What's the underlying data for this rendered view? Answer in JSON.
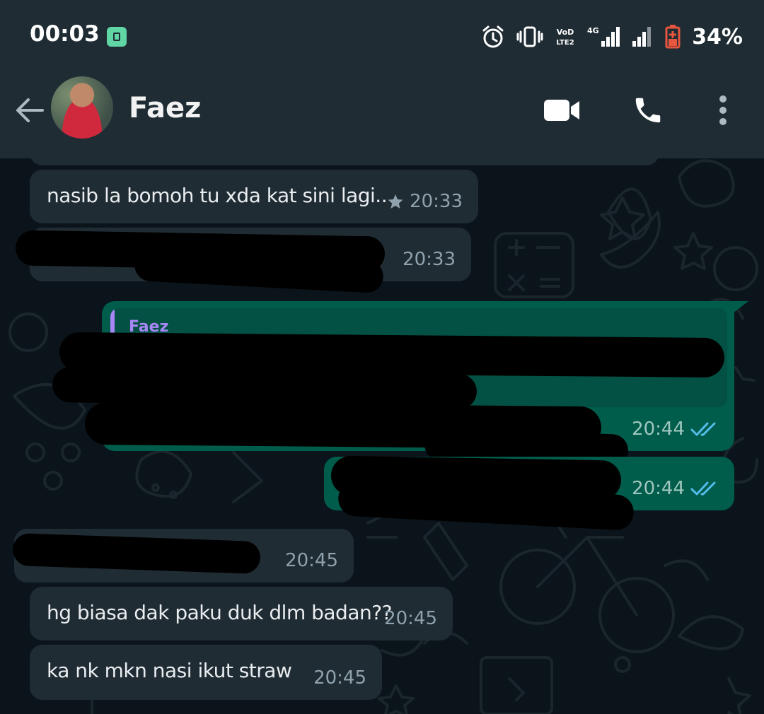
{
  "status_bar": {
    "time": "00:03",
    "battery_percent": "34%",
    "network": "4G",
    "volte": "VoLTE"
  },
  "header": {
    "contact_name": "Faez"
  },
  "messages": [
    {
      "direction": "incoming",
      "text": "nasib la bomoh tu xda kat sini lagi..",
      "time": "20:33",
      "starred": true
    },
    {
      "direction": "incoming",
      "text": "",
      "time": "20:33",
      "redacted": true
    },
    {
      "direction": "outgoing",
      "quoted_name": "Faez",
      "text": "",
      "time": "20:44",
      "read": true,
      "redacted": true
    },
    {
      "direction": "outgoing",
      "text": "",
      "time": "20:44",
      "read": true,
      "redacted": true
    },
    {
      "direction": "incoming",
      "text": "",
      "time": "20:45",
      "redacted": true
    },
    {
      "direction": "incoming",
      "text": "hg biasa dak paku duk dlm badan??",
      "time": "20:45"
    },
    {
      "direction": "incoming",
      "text": "ka nk mkn nasi ikut straw",
      "time": "20:45"
    }
  ],
  "colors": {
    "background": "#0b141a",
    "bar": "#1f2c34",
    "incoming_bubble": "#202c33",
    "outgoing_bubble": "#005c4b",
    "read_tick": "#53bdeb",
    "quote_accent": "#a886f5"
  }
}
